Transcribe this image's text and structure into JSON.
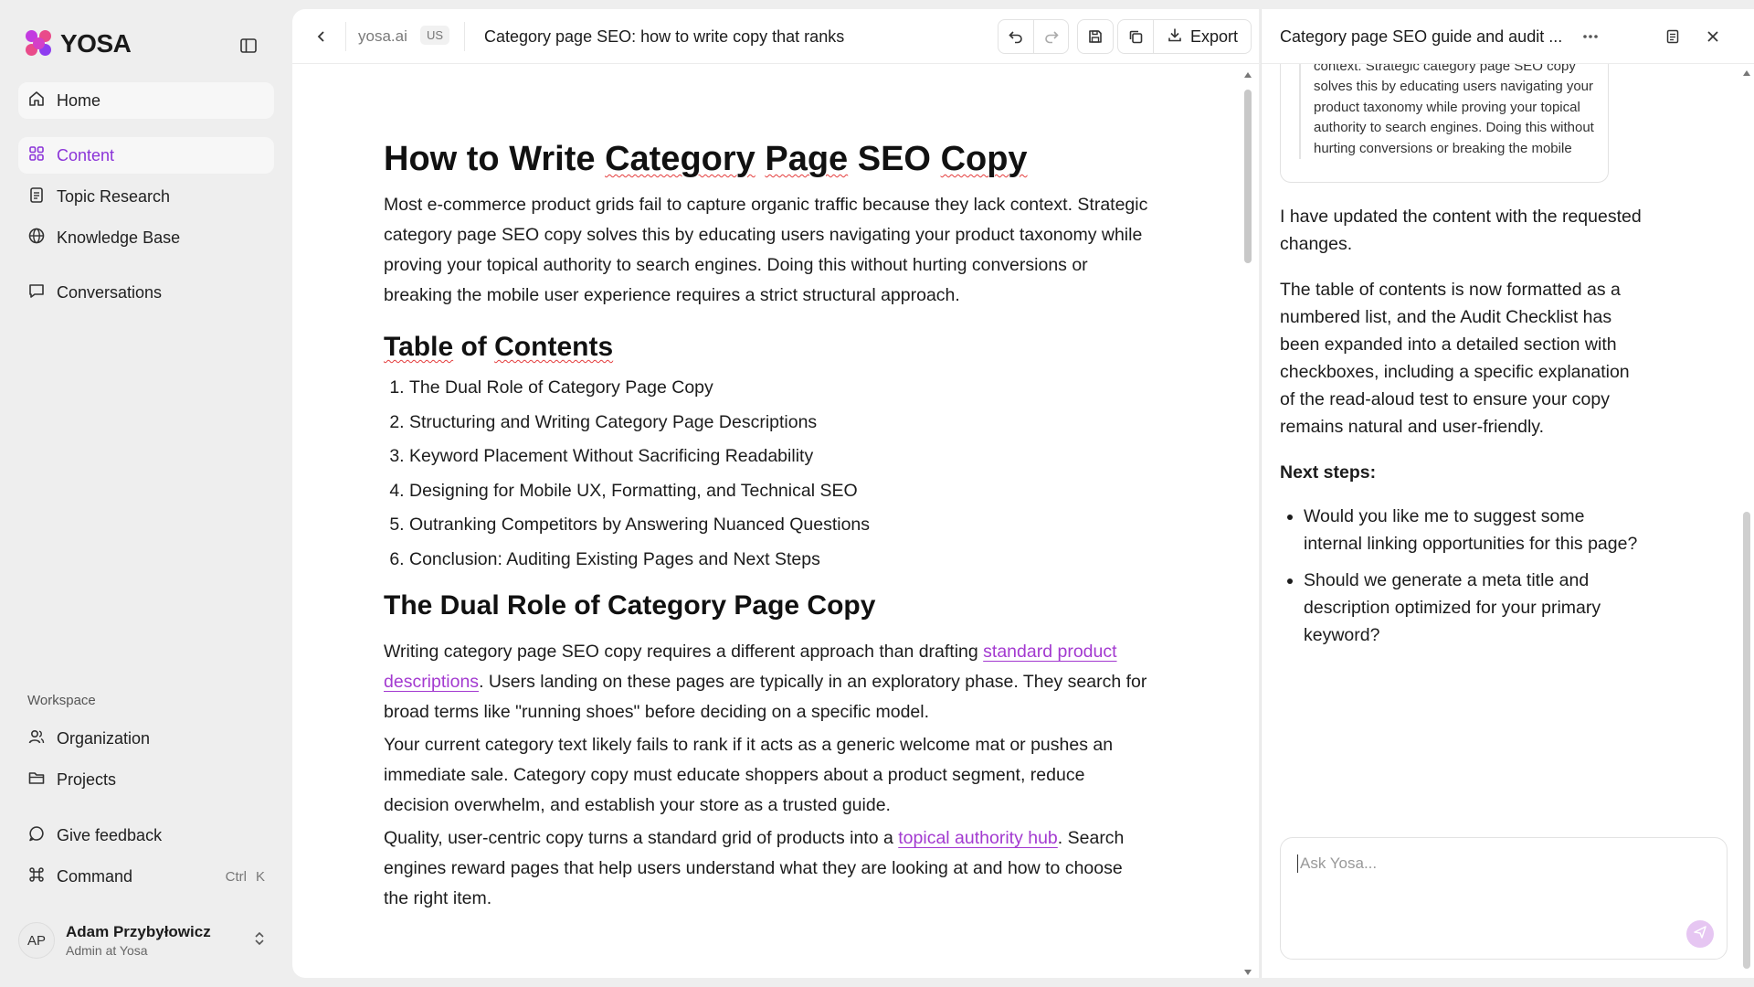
{
  "brand": {
    "name": "YOSA"
  },
  "sidebar": {
    "nav": [
      {
        "label": "Home",
        "icon": "home-icon"
      },
      {
        "label": "Content",
        "icon": "content-icon"
      },
      {
        "label": "Topic Research",
        "icon": "clipboard-icon"
      },
      {
        "label": "Knowledge Base",
        "icon": "globe-icon"
      },
      {
        "label": "Conversations",
        "icon": "chat-icon"
      }
    ],
    "workspace_label": "Workspace",
    "workspace": [
      {
        "label": "Organization",
        "icon": "users-icon"
      },
      {
        "label": "Projects",
        "icon": "folder-icon"
      }
    ],
    "feedback_label": "Give feedback",
    "command_label": "Command",
    "command_keys": [
      "Ctrl",
      "K"
    ],
    "user": {
      "initials": "AP",
      "name": "Adam Przybyłowicz",
      "role": "Admin at Yosa"
    }
  },
  "editor": {
    "domain": "yosa.ai",
    "locale": "US",
    "title": "Category page SEO: how to write copy that ranks",
    "export_label": "Export"
  },
  "document": {
    "h1": [
      "How to Write ",
      "Category",
      " ",
      "Page",
      " SEO ",
      "Copy"
    ],
    "intro": "Most e-commerce product grids fail to capture organic traffic because they lack context. Strategic category page SEO copy solves this by educating users navigating your product taxonomy while proving your topical authority to search engines. Doing this without hurting conversions or breaking the mobile user experience requires a strict structural approach.",
    "toc_heading": [
      "Table",
      " of ",
      "Contents"
    ],
    "toc": [
      "The Dual Role of Category Page Copy",
      "Structuring and Writing Category Page Descriptions",
      "Keyword Placement Without Sacrificing Readability",
      "Designing for Mobile UX, Formatting, and Technical SEO",
      "Outranking Competitors by Answering Nuanced Questions",
      "Conclusion: Auditing Existing Pages and Next Steps"
    ],
    "section1_heading": "The Dual Role of Category Page Copy",
    "p1_before": "Writing category page SEO copy requires a different approach than drafting ",
    "p1_link": "standard product descriptions",
    "p1_after": ". Users landing on these pages are typically in an exploratory phase. They search for broad terms like \"running shoes\" before deciding on a specific model.",
    "p2": "Your current category text likely fails to rank if it acts as a generic welcome mat or pushes an immediate sale. Category copy must educate shoppers about a product segment, reduce decision overwhelm, and establish your store as a trusted guide.",
    "p3_before": "Quality, user-centric copy turns a standard grid of products into a ",
    "p3_link": "topical authority hub",
    "p3_after": ". Search engines reward pages that help users understand what they are looking at and how to choose the right item."
  },
  "chat": {
    "title": "Category page SEO guide and audit ...",
    "quote": "capture organic traffic because they lack context. Strategic category page SEO copy solves this by educating users navigating your product taxonomy while proving your topical authority to search engines. Doing this without hurting conversions or breaking the mobile",
    "msg1": "I have updated the content with the requested changes.",
    "msg2": "The table of contents is now formatted as a numbered list, and the Audit Checklist has been expanded into a detailed section with checkboxes, including a specific explanation of the read-aloud test to ensure your copy remains natural and user-friendly.",
    "next_steps": "Next steps:",
    "bullets": [
      "Would you like me to suggest some internal linking opportunities for this page?",
      "Should we generate a meta title and description optimized for your primary keyword?"
    ],
    "input_placeholder": "Ask Yosa..."
  },
  "colors": {
    "accent": "#8b34d8",
    "link": "#a33ad0",
    "spell": "#e43d3d",
    "background": "#eeeeee"
  }
}
